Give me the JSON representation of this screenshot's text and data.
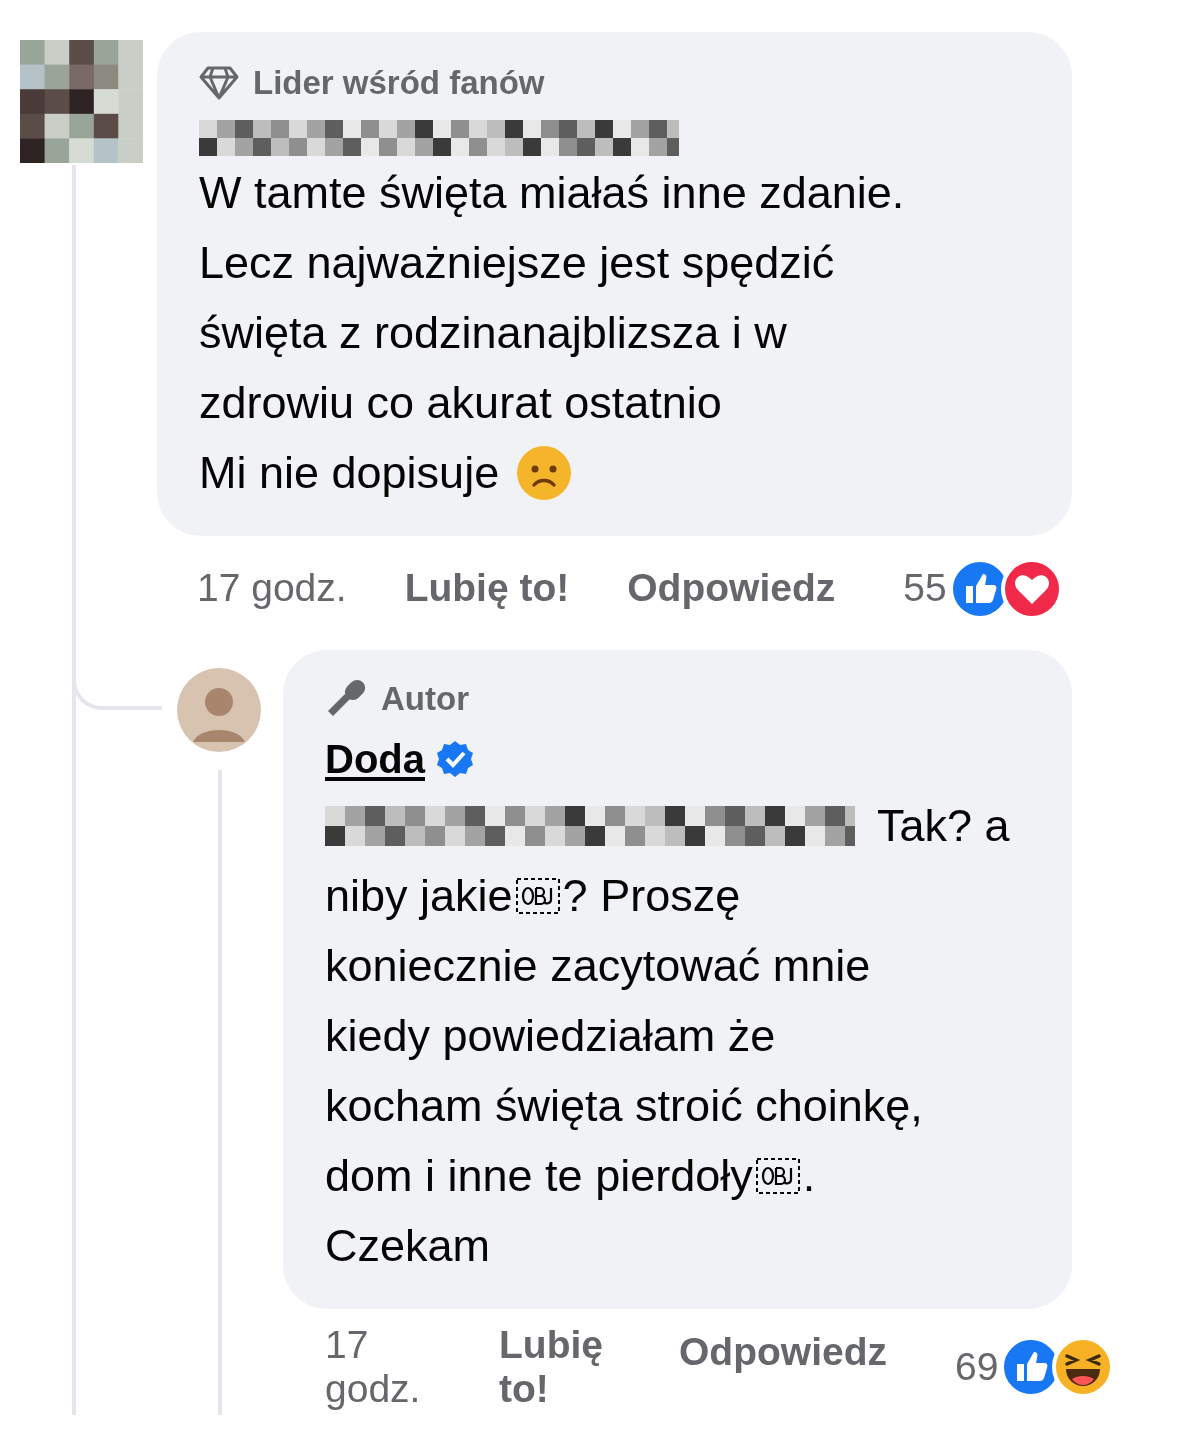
{
  "comments": [
    {
      "badge": {
        "kind": "top_fan",
        "label": "Lider wśród fanów"
      },
      "lines": [
        [
          {
            "kind": "text",
            "text": "W tamte święta miałaś inne zdanie."
          }
        ],
        [
          {
            "kind": "text",
            "text": "Lecz najważniejsze jest spędzić"
          }
        ],
        [
          {
            "kind": "text",
            "text": "święta z rodzinanajblizsza i w"
          }
        ],
        [
          {
            "kind": "text",
            "text": "zdrowiu co akurat ostatnio"
          }
        ],
        [
          {
            "kind": "text",
            "text": "Mi nie dopisuje"
          },
          {
            "kind": "emoji"
          }
        ]
      ],
      "time": "17 godz.",
      "like_label": "Lubię to!",
      "reply_label": "Odpowiedz",
      "reaction_count": "55",
      "reactions": [
        {
          "kind": "like"
        },
        {
          "kind": "love"
        }
      ]
    },
    {
      "badge": {
        "kind": "author",
        "label": "Autor"
      },
      "author": "Doda",
      "verified": true,
      "lines": [
        [
          {
            "kind": "redacted"
          },
          {
            "kind": "text",
            "text": "Tak? a"
          }
        ],
        [
          {
            "kind": "text",
            "text": "niby jakie"
          },
          {
            "kind": "object"
          },
          {
            "kind": "text",
            "text": "? Proszę"
          }
        ],
        [
          {
            "kind": "text",
            "text": "koniecznie zacytować mnie"
          }
        ],
        [
          {
            "kind": "text",
            "text": "kiedy powiedziałam że"
          }
        ],
        [
          {
            "kind": "text",
            "text": "kocham święta stroić choinkę,"
          }
        ],
        [
          {
            "kind": "text",
            "text": "dom i inne te pierdoły"
          },
          {
            "kind": "object"
          },
          {
            "kind": "text",
            "text": "."
          }
        ],
        [
          {
            "kind": "text",
            "text": "Czekam"
          }
        ]
      ],
      "time": "17 godz.",
      "like_label": "Lubię to!",
      "reply_label": "Odpowiedz",
      "reaction_count": "69",
      "reactions": [
        {
          "kind": "like"
        },
        {
          "kind": "haha"
        }
      ]
    }
  ]
}
